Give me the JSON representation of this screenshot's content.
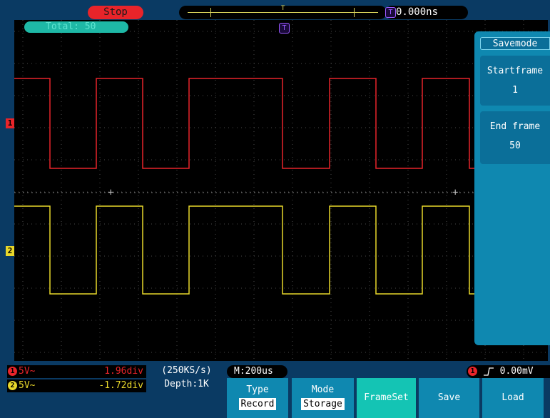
{
  "status": {
    "run_state": "Stop",
    "time_offset": "0.000ns",
    "total": "Total: 50"
  },
  "markers": {
    "trigger": "T",
    "ch1": "1",
    "ch2": "2"
  },
  "side_menu": {
    "title": "Savemode",
    "start_frame": {
      "label": "Startframe",
      "value": "1"
    },
    "end_frame": {
      "label": "End frame",
      "value": "50"
    }
  },
  "channels": {
    "ch1": {
      "volt_div": "5V~",
      "offset": "1.96div",
      "color": "#e8242a"
    },
    "ch2": {
      "volt_div": "5V~",
      "offset": "-1.72div",
      "color": "#e8d72a"
    }
  },
  "acquisition": {
    "sample_rate": "(250KS/s)",
    "depth": "Depth:1K",
    "timebase": "M:200us"
  },
  "trigger": {
    "source": "1",
    "slope": "rising",
    "level": "0.00mV"
  },
  "bottom_menu": [
    {
      "label": "Type",
      "value": "Record"
    },
    {
      "label": "Mode",
      "value": "Storage"
    },
    {
      "label": "FrameSet",
      "value": ""
    },
    {
      "label": "Save",
      "value": ""
    },
    {
      "label": "Load",
      "value": ""
    }
  ],
  "colors": {
    "background": "#0a3a63",
    "screen": "#000000",
    "menu": "#0f88b0",
    "menu_active": "#14c4b4"
  }
}
